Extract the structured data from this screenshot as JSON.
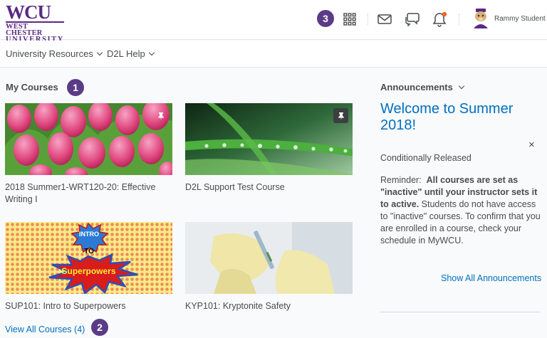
{
  "logo": {
    "line1": "WCU",
    "line2": "WEST CHESTER",
    "line3": "UNIVERSITY"
  },
  "badges": {
    "one": "1",
    "two": "2",
    "three": "3"
  },
  "header_icons": [
    "waffle-icon",
    "mail-icon",
    "chat-icon",
    "bell-icon"
  ],
  "user": {
    "name": "Rammy Student"
  },
  "nav": {
    "items": [
      "University Resources",
      "D2L Help"
    ]
  },
  "my_courses": {
    "heading": "My Courses",
    "courses": [
      {
        "title": "2018 Summer1-WRT120-20: Effective Writing I",
        "image": "pink tulips",
        "pinned": true
      },
      {
        "title": "D2L Support Test Course",
        "image": "grass with dew drops",
        "pinned": true
      },
      {
        "title": "SUP101: Intro to Superpowers",
        "image": "comic intro to superpowers",
        "pinned": false
      },
      {
        "title": "KYP101: Kryptonite Safety",
        "image": "lab gloves with vial",
        "pinned": false
      }
    ],
    "view_all": "View All Courses (4)"
  },
  "comic_text": {
    "intro": "INTRO",
    "to": "TO",
    "super": "Superpowers"
  },
  "announcements": {
    "heading": "Announcements",
    "title": "Welcome to Summer 2018!",
    "close": "×",
    "status": "Conditionally Released",
    "p1": "Reminder:",
    "p2": "All courses are set as \"inactive\" until your instructor sets it to active.",
    "p3": "Students do not have access to \"inactive\" courses.  To confirm that you are enrolled in a course, check your schedule in MyWCU.",
    "show_all": "Show All Announcements"
  },
  "colors": {
    "brand": "#5a2a82",
    "link": "#006fbf",
    "notification": "#f26522"
  }
}
